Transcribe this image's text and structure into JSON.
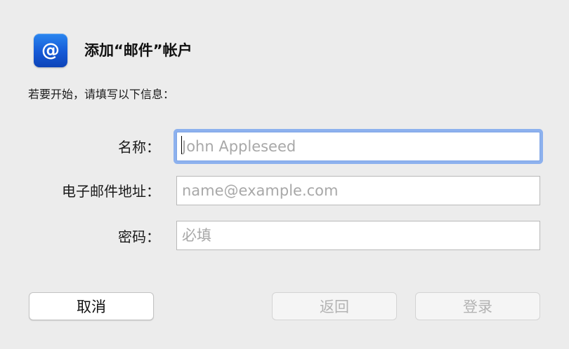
{
  "dialog": {
    "icon": "at-sign-icon",
    "icon_glyph": "@",
    "title": "添加“邮件”帐户",
    "instructions": "若要开始，请填写以下信息："
  },
  "form": {
    "name": {
      "label": "名称：",
      "value": "",
      "placeholder": "John Appleseed",
      "focused": true
    },
    "email": {
      "label": "电子邮件地址：",
      "value": "",
      "placeholder": "name@example.com"
    },
    "password": {
      "label": "密码：",
      "value": "",
      "placeholder": "必填"
    }
  },
  "buttons": {
    "cancel": {
      "label": "取消",
      "enabled": true
    },
    "back": {
      "label": "返回",
      "enabled": false
    },
    "login": {
      "label": "登录",
      "enabled": false
    }
  },
  "colors": {
    "accent": "#1a6ee8",
    "focus_ring": "#8db1ee",
    "background": "#ececec"
  }
}
